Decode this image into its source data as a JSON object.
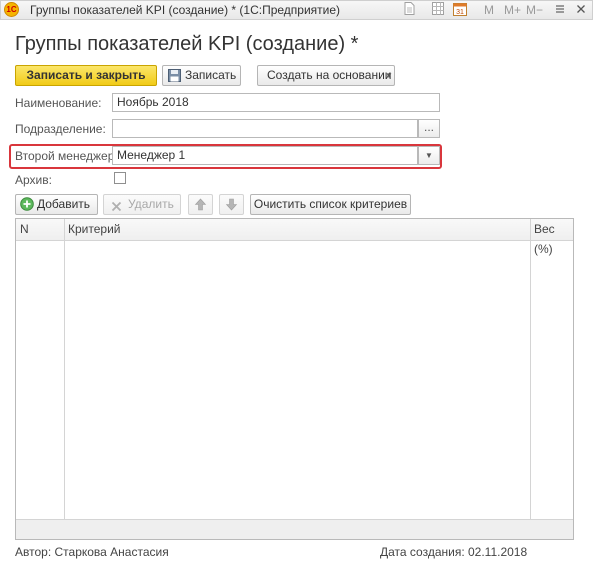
{
  "window": {
    "logo_text": "1С",
    "title": "Группы показателей KPI (создание) * (1С:Предприятие)",
    "m_buttons": [
      "M",
      "M+",
      "M−"
    ]
  },
  "form": {
    "title": "Группы показателей KPI (создание) *"
  },
  "toolbar": {
    "save_close_label": "Записать и закрыть",
    "save_label": "Записать",
    "create_based_label": "Создать на основании"
  },
  "fields": {
    "name_label": "Наименование:",
    "name_value": "Ноябрь 2018",
    "department_label": "Подразделение:",
    "department_value": "",
    "second_manager_label": "Второй менеджер:",
    "second_manager_value": "Менеджер 1",
    "archive_label": "Архив:"
  },
  "table_toolbar": {
    "add_label": "Добавить",
    "delete_label": "Удалить",
    "clear_label": "Очистить список критериев"
  },
  "table": {
    "columns": [
      "N",
      "Критерий",
      "Вес (%)"
    ],
    "rows": []
  },
  "footer": {
    "author": "Автор: Старкова Анастасия",
    "created": "Дата создания: 02.11.2018"
  },
  "colors": {
    "primary_button": "#f5d327",
    "highlight_border": "#d9363c",
    "add_icon": "#4caf50"
  }
}
